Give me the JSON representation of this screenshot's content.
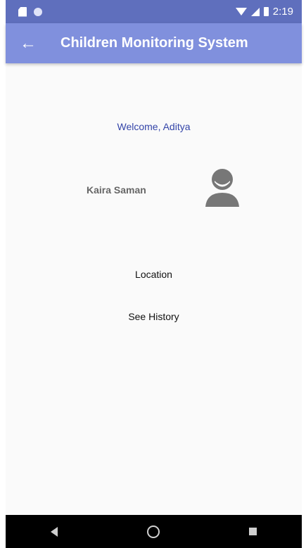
{
  "status_bar": {
    "time": "2:19",
    "icons": [
      "sd-card-icon",
      "circle-notification-icon",
      "wifi-icon",
      "signal-icon",
      "battery-icon"
    ]
  },
  "app_bar": {
    "back_icon": "arrow-left-icon",
    "title": "Children Monitoring System",
    "color": "#8090dd"
  },
  "main": {
    "welcome": "Welcome, Aditya",
    "child": {
      "name": "Kaira Saman",
      "avatar_icon": "person-avatar-icon"
    },
    "buttons": {
      "location": "Location",
      "history": "See History"
    }
  },
  "nav_bar": {
    "icons": [
      "back-triangle-icon",
      "home-circle-icon",
      "recent-apps-square-icon"
    ]
  }
}
